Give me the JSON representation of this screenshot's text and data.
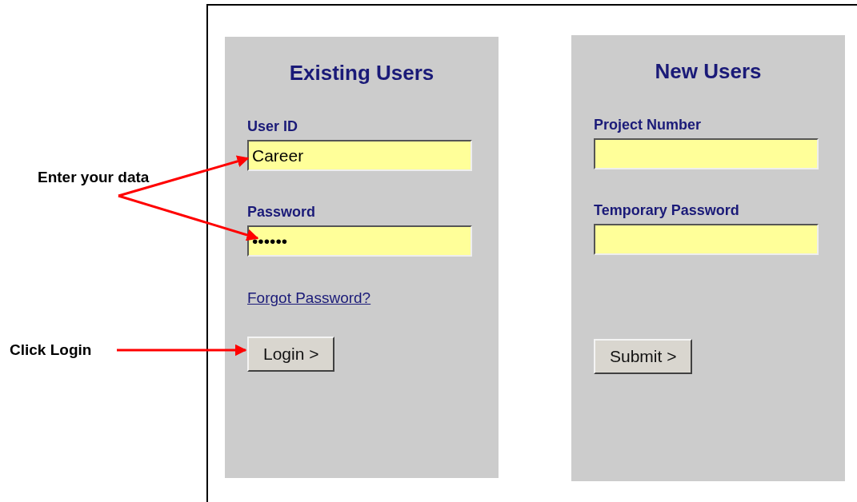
{
  "annotations": [
    {
      "text": "Enter your data"
    },
    {
      "text": "Click Login"
    }
  ],
  "panels": [
    {
      "title": "Existing Users",
      "fields": [
        {
          "label": "User ID",
          "value": "Career"
        },
        {
          "label": "Password",
          "value": "••••••"
        }
      ],
      "link": "Forgot Password?",
      "button": "Login >"
    },
    {
      "title": "New Users",
      "fields": [
        {
          "label": "Project Number"
        },
        {
          "label": "Temporary Password"
        }
      ],
      "button": "Submit >"
    }
  ]
}
